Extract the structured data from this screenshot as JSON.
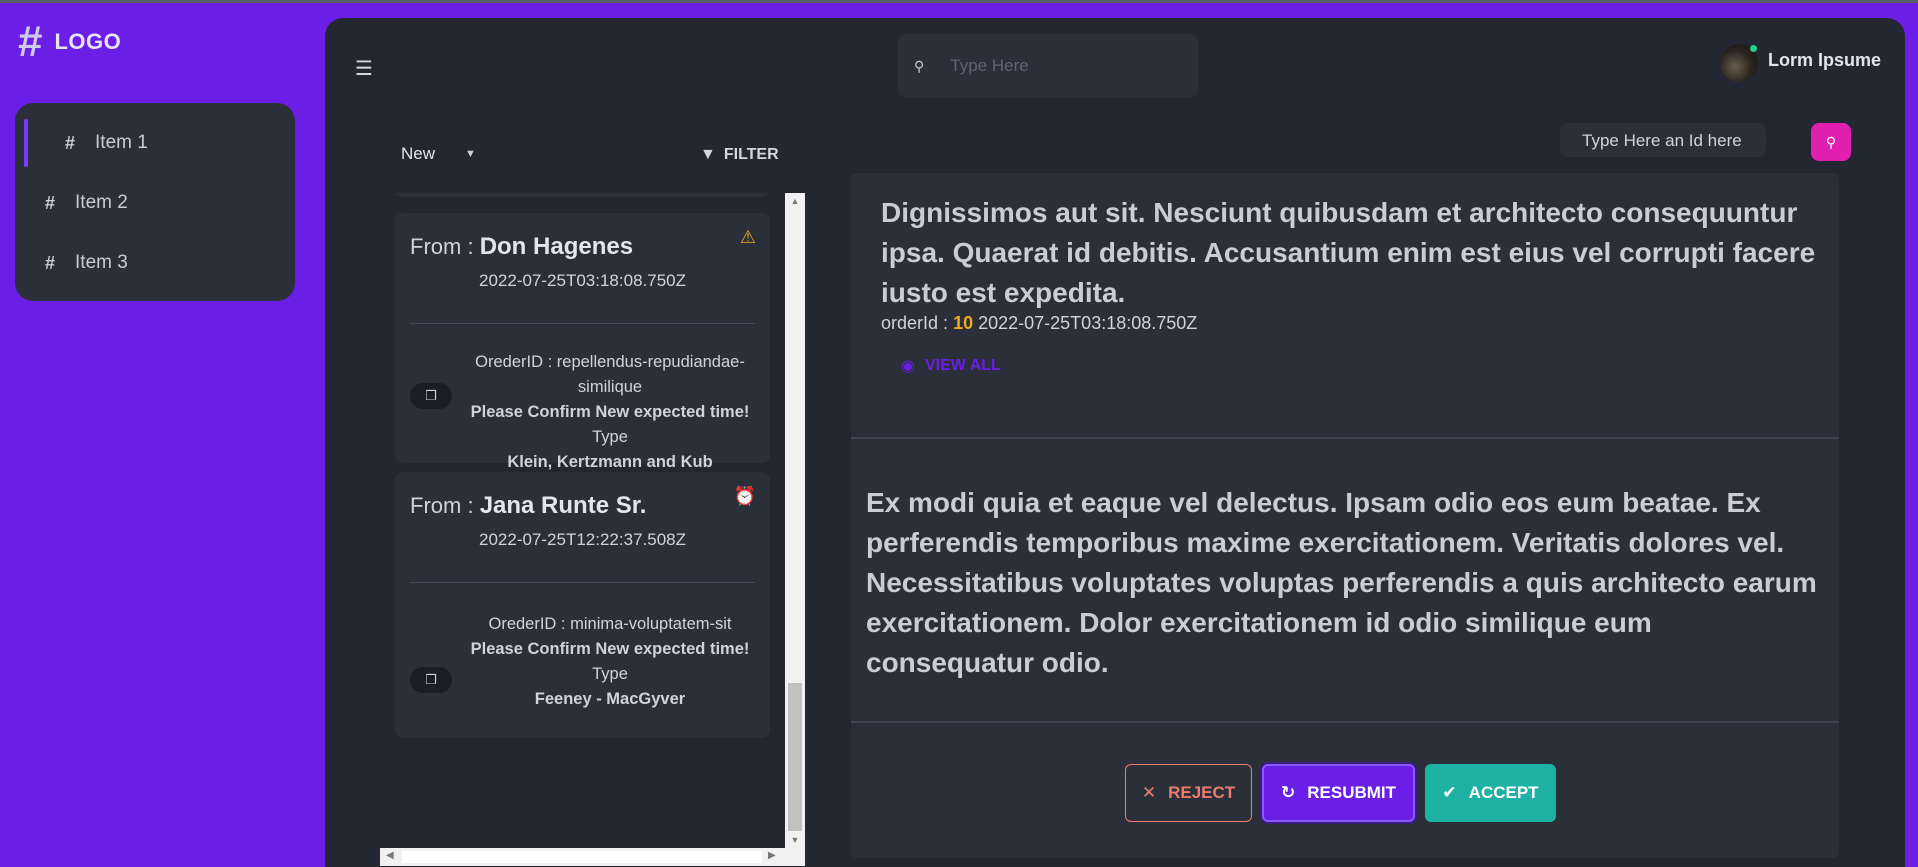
{
  "brand": {
    "logo_text": "LOGO",
    "logo_icon": "hash-icon"
  },
  "sidebar": {
    "items": [
      {
        "label": "Item 1",
        "icon": "hash-icon",
        "active": true
      },
      {
        "label": "Item 2",
        "icon": "hash-icon",
        "active": false
      },
      {
        "label": "Item 3",
        "icon": "hash-icon",
        "active": false
      }
    ]
  },
  "header": {
    "search_placeholder": "Type Here",
    "user_name": "Lorm Ipsume"
  },
  "list": {
    "status_select": "New",
    "filter_label": "FILTER",
    "cards": [
      {
        "from_label": "From :",
        "from_name": "Don Hagenes",
        "date": "2022-07-25T03:18:08.750Z",
        "status_icon": "warning-icon",
        "order_line": "OrederID : repellendus-repudiandae-similique",
        "message": "Please Confirm New expected time!",
        "type_label": "Type",
        "type_value": "Klein, Kertzmann and Kub"
      },
      {
        "from_label": "From :",
        "from_name": "Jana Runte Sr.",
        "date": "2022-07-25T12:22:37.508Z",
        "status_icon": "alarm-clock-icon",
        "order_line": "OrederID : minima-voluptatem-sit",
        "message": "Please Confirm New expected time!",
        "type_label": "Type",
        "type_value": "Feeney - MacGyver"
      }
    ]
  },
  "detail": {
    "id_search_placeholder": "Type Here an Id here",
    "title": "Dignissimos aut sit. Nesciunt quibusdam et architecto consequuntur ipsa. Quaerat id debitis. Accusantium enim est eius vel corrupti facere iusto est expedita.",
    "order_label": "orderId :",
    "order_id": "10",
    "order_date": "2022-07-25T03:18:08.750Z",
    "view_all_label": "VIEW ALL",
    "description": "Ex modi quia et eaque vel delectus. Ipsam odio eos eum beatae. Ex perferendis temporibus maxime exercitationem. Veritatis dolores vel. Necessitatibus voluptates voluptas perferendis a quis architecto earum exercitationem. Dolor exercitationem id odio similique eum consequatur odio.",
    "reject_label": "REJECT",
    "resubmit_label": "RESUBMIT",
    "accept_label": "ACCEPT"
  },
  "colors": {
    "brand_purple": "#6a1ee6",
    "panel": "#222731",
    "card": "#2a2f3a",
    "accent_pink": "#e11fb0",
    "accept_teal": "#1db2a4",
    "reject_red": "#f07b6b",
    "order_id_orange": "#f0a91c"
  }
}
